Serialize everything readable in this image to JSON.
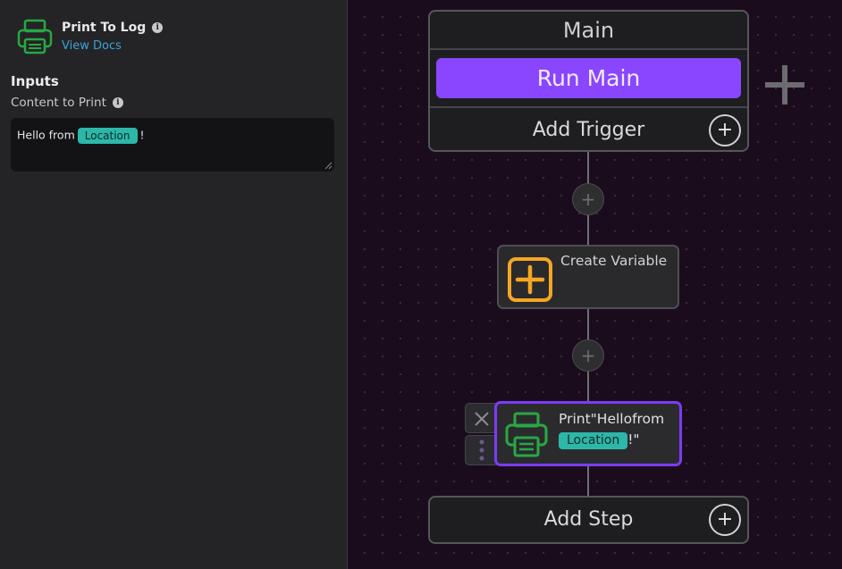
{
  "sidebar": {
    "title": "Print To Log",
    "docs_link": "View Docs",
    "section_heading": "Inputs",
    "field_label": "Content to Print",
    "field_value": {
      "prefix": "Hello from",
      "token": "Location",
      "suffix": "!"
    }
  },
  "canvas": {
    "main_card": {
      "title": "Main",
      "run_button": "Run Main",
      "add_trigger": "Add Trigger",
      "plus_glyph": "+"
    },
    "add_step_glyph": "+",
    "nodes": [
      {
        "label": "Create Variable",
        "icon": "plus-square-icon",
        "icon_color": "#f5a623"
      },
      {
        "label_prefix": "Print\"Hellofrom",
        "token": "Location",
        "label_suffix": "!\"",
        "icon": "printer-icon",
        "icon_color": "#27a844",
        "selected": true
      }
    ],
    "add_step": "Add Step"
  },
  "colors": {
    "accent": "#8a46ff",
    "selected_border": "#7b3cf5",
    "token": "#2cb7a8",
    "link": "#3aa3d8",
    "printer_green": "#27a844",
    "variable_orange": "#f5a623"
  }
}
